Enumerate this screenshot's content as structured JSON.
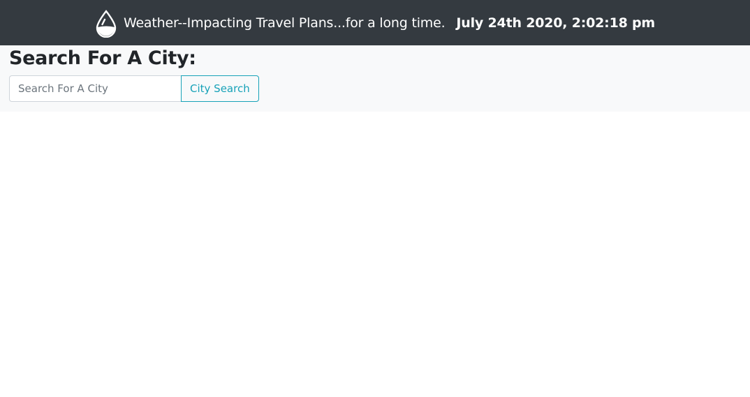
{
  "header": {
    "icon": "water-drop-icon",
    "title": "Weather--Impacting Travel Plans...for a long time.",
    "datetime": "July 24th 2020, 2:02:18 pm"
  },
  "search": {
    "heading": "Search For A City:",
    "placeholder": "Search For A City",
    "value": "",
    "button_label": "City Search"
  },
  "colors": {
    "navbar_bg": "#343a40",
    "panel_bg": "#f8f9fa",
    "accent": "#17a2b8"
  }
}
